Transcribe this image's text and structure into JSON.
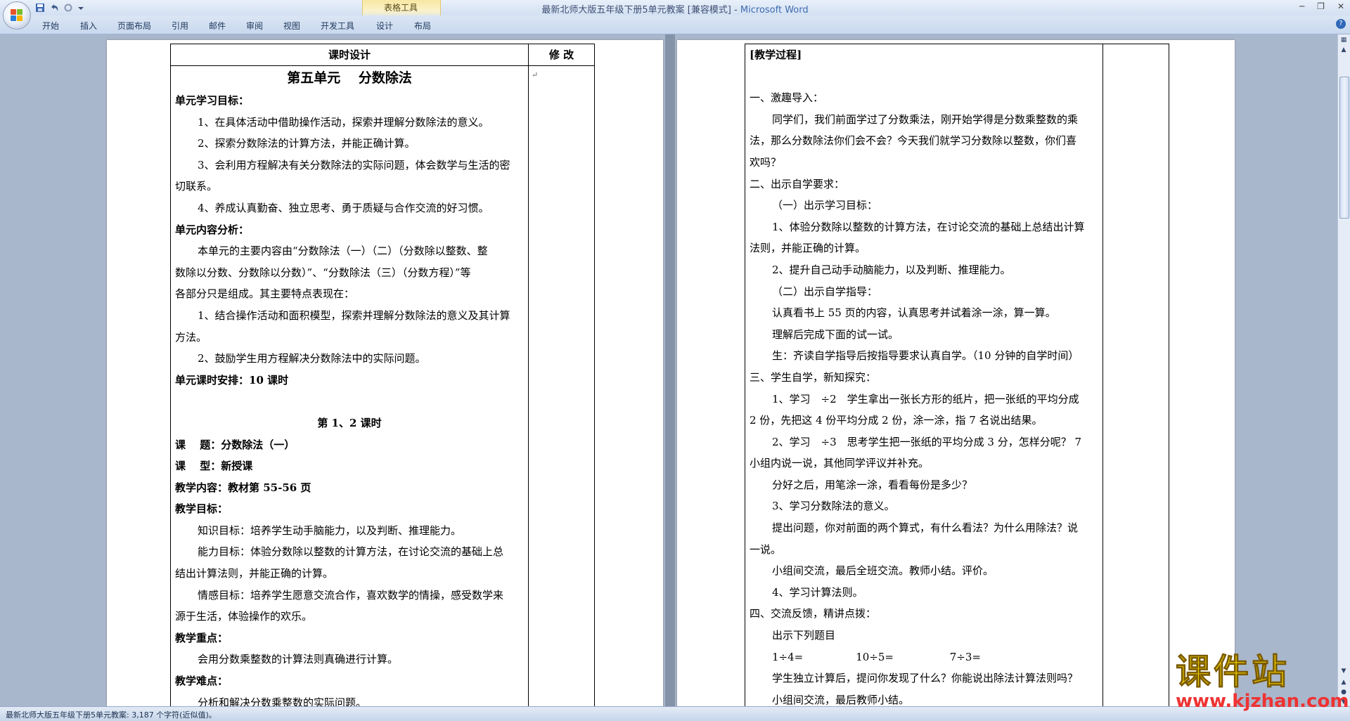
{
  "window": {
    "title_doc": "最新北师大版五年级下册5单元教案 [兼容模式]",
    "title_sep": " - ",
    "title_app": "Microsoft Word",
    "contextual_label": "表格工具"
  },
  "ribbon": {
    "tabs": [
      "开始",
      "插入",
      "页面布局",
      "引用",
      "邮件",
      "审阅",
      "视图",
      "开发工具",
      "设计",
      "布局"
    ]
  },
  "page1": {
    "header_left": "课时设计",
    "header_right": "修 改",
    "lines": [
      {
        "text": "第五单元　 分数除法",
        "style": "big"
      },
      {
        "text": "单元学习目标：",
        "style": "b"
      },
      {
        "text": "1、在具体活动中借助操作活动，探索并理解分数除法的意义。",
        "style": "ind"
      },
      {
        "text": "2、探索分数除法的计算方法，并能正确计算。",
        "style": "ind"
      },
      {
        "text": "3、会利用方程解决有关分数除法的实际问题，体会数学与生活的密",
        "style": "ind"
      },
      {
        "text": "切联系。",
        "style": ""
      },
      {
        "text": "4、养成认真勤奋、独立思考、勇于质疑与合作交流的好习惯。",
        "style": "ind"
      },
      {
        "text": "单元内容分析：",
        "style": "b"
      },
      {
        "text": "本单元的主要内容由“分数除法（一）（二）（分数除以整数、整",
        "style": "ind"
      },
      {
        "text": "数除以分数、分数除以分数）”、“分数除法（三）（分数方程）”等",
        "style": ""
      },
      {
        "text": "各部分只是组成。其主要特点表现在：",
        "style": ""
      },
      {
        "text": "1、结合操作活动和面积模型，探索并理解分数除法的意义及其计算",
        "style": "ind"
      },
      {
        "text": "方法。",
        "style": ""
      },
      {
        "text": "2、鼓励学生用方程解决分数除法中的实际问题。",
        "style": "ind"
      },
      {
        "text": "单元课时安排：10 课时",
        "style": "b"
      },
      {
        "text": "",
        "style": "center"
      },
      {
        "text": "第 1、2 课时",
        "style": "b center"
      },
      {
        "text": "课　 题：分数除法（一）",
        "style": "b"
      },
      {
        "text": "课　 型：新授课",
        "style": "b"
      },
      {
        "text": "教学内容：教材第 55-56 页",
        "style": "b"
      },
      {
        "text": "教学目标：",
        "style": "b"
      },
      {
        "text": "知识目标：培养学生动手脑能力，以及判断、推理能力。",
        "style": "ind"
      },
      {
        "text": "能力目标：体验分数除以整数的计算方法，在讨论交流的基础上总",
        "style": "ind"
      },
      {
        "text": "结出计算法则，并能正确的计算。",
        "style": ""
      },
      {
        "text": "情感目标：培养学生愿意交流合作，喜欢数学的情操，感受数学来",
        "style": "ind"
      },
      {
        "text": "源于生活，体验操作的欢乐。",
        "style": ""
      },
      {
        "text": "教学重点：",
        "style": "b"
      },
      {
        "text": "会用分数乘整数的计算法则真确进行计算。",
        "style": "ind"
      },
      {
        "text": "教学难点：",
        "style": "b"
      },
      {
        "text": "分析和解决分数乘整数的实际问题。",
        "style": "ind"
      }
    ]
  },
  "page2": {
    "lines": [
      {
        "text": "[教学过程]",
        "style": "b"
      },
      {
        "text": "",
        "style": ""
      },
      {
        "text": "一、激趣导入：",
        "style": ""
      },
      {
        "text": "同学们，我们前面学过了分数乘法，刚开始学得是分数乘整数的乘",
        "style": "ind"
      },
      {
        "text": "法，那么分数除法你们会不会？今天我们就学习分数除以整数，你们喜",
        "style": ""
      },
      {
        "text": "欢吗？",
        "style": ""
      },
      {
        "text": "二、出示自学要求：",
        "style": ""
      },
      {
        "text": "（一）出示学习目标：",
        "style": "ind"
      },
      {
        "text": "1、体验分数除以整数的计算方法，在讨论交流的基础上总结出计算",
        "style": "ind"
      },
      {
        "text": "法则，并能正确的计算。",
        "style": ""
      },
      {
        "text": "2、提升自己动手动脑能力，以及判断、推理能力。",
        "style": "ind"
      },
      {
        "text": "（二）出示自学指导：",
        "style": "ind"
      },
      {
        "text": "认真看书上 55 页的内容，认真思考并试着涂一涂，算一算。",
        "style": "ind"
      },
      {
        "text": "理解后完成下面的试一试。",
        "style": "ind"
      },
      {
        "text": "生：齐读自学指导后按指导要求认真自学。（10 分钟的自学时间）",
        "style": "ind"
      },
      {
        "text": "三、学生自学，新知探究：",
        "style": ""
      },
      {
        "text": "1、学习　÷2　学生拿出一张长方形的纸片，把一张纸的平均分成",
        "style": "ind"
      },
      {
        "text": "2 份，先把这 4 份平均分成 2 份，涂一涂，指 7 名说出结果。",
        "style": ""
      },
      {
        "text": "2、学习　÷3　思考学生把一张纸的平均分成 3 分，怎样分呢？ 7",
        "style": "ind"
      },
      {
        "text": "小组内说一说，其他同学评议并补充。",
        "style": ""
      },
      {
        "text": "分好之后，用笔涂一涂，看看每份是多少？",
        "style": "ind"
      },
      {
        "text": "3、学习分数除法的意义。",
        "style": "ind"
      },
      {
        "text": "提出问题，你对前面的两个算式，有什么看法？为什么用除法？说",
        "style": "ind"
      },
      {
        "text": "一说。",
        "style": ""
      },
      {
        "text": "小组间交流，最后全班交流。教师小结。评价。",
        "style": "ind"
      },
      {
        "text": "4、学习计算法则。",
        "style": "ind"
      },
      {
        "text": "四、交流反馈，精讲点拨：",
        "style": ""
      },
      {
        "text": "出示下列题目",
        "style": "ind"
      },
      {
        "text": "1÷4=　　　　　10÷5=　　　　　 7÷3=",
        "style": "ind"
      },
      {
        "text": "学生独立计算后，提问你发现了什么？你能说出除法计算法则吗？",
        "style": "ind"
      },
      {
        "text": "小组间交流，最后教师小结。",
        "style": "ind"
      }
    ]
  },
  "status": {
    "text": "最新北师大版五年级下册5单元教案: 3,187 个字符(近似值)。"
  },
  "watermark": {
    "cn": "课件站",
    "url": "www.kjzhan.com"
  },
  "colors": {
    "accent": "#3d6bb0",
    "watermark_yellow": "#f2d300",
    "watermark_red": "#ee3333"
  }
}
